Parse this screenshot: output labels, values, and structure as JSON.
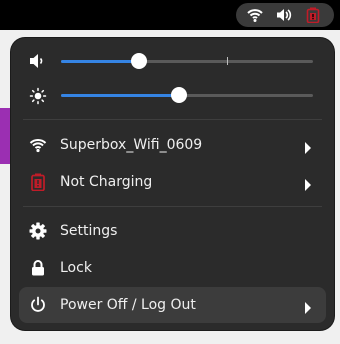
{
  "topbar": {
    "indicators": [
      "wifi-icon",
      "volume-icon",
      "battery-not-charging-icon"
    ]
  },
  "quick_menu": {
    "volume": {
      "icon": "volume-low-icon",
      "level": 0.31,
      "max_marker": 0.66
    },
    "brightness": {
      "icon": "brightness-icon",
      "level": 0.47
    },
    "items": [
      {
        "label": "Superbox_Wifi_0609",
        "icon": "wifi-icon",
        "submenu": true
      },
      {
        "label": "Not Charging",
        "icon": "battery-not-charging-icon",
        "submenu": true
      },
      {
        "label": "Settings",
        "icon": "gear-icon",
        "submenu": false
      },
      {
        "label": "Lock",
        "icon": "lock-icon",
        "submenu": false
      },
      {
        "label": "Power Off / Log Out",
        "icon": "power-icon",
        "submenu": true
      }
    ]
  },
  "colors": {
    "accent": "#3584e4",
    "menu_bg": "#2b2b2b",
    "battery_alert": "#c01c28"
  }
}
